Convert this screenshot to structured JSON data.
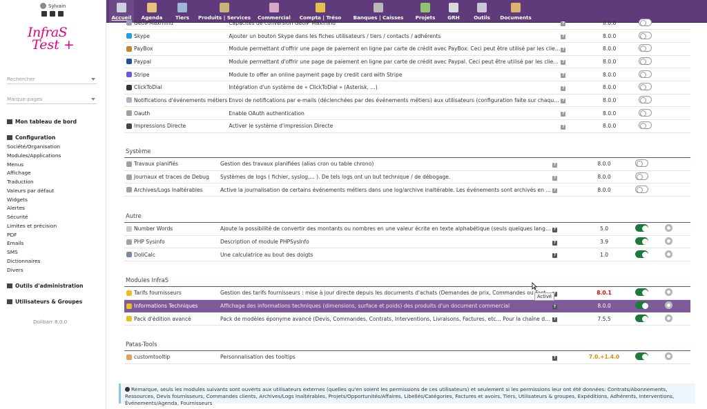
{
  "user": {
    "name": "Sylvain"
  },
  "logo": {
    "line1": "InfraS",
    "line2": "Test +"
  },
  "search": {
    "placeholder": "Rechercher"
  },
  "bookmarks": {
    "placeholder": "Marque-pages"
  },
  "left_menu": {
    "dashboard": "Mon tableau de bord",
    "configuration": "Configuration",
    "config_items": [
      "Société/Organisation",
      "Modules/Applications",
      "Menus",
      "Affichage",
      "Traduction",
      "Valeurs par défaut",
      "Widgets",
      "Alertes",
      "Sécurité",
      "Limites et précision",
      "PDF",
      "Emails",
      "SMS",
      "Dictionnaires",
      "Divers"
    ],
    "admin_tools": "Outils d'administration",
    "users_groups": "Utilisateurs & Groupes",
    "version": "Dolibarr 8.0.0"
  },
  "tabs": [
    {
      "label": "Accueil",
      "color": "#cfcfe0"
    },
    {
      "label": "Agenda",
      "color": "#e7c27a"
    },
    {
      "label": "Tiers",
      "color": "#9db6d8"
    },
    {
      "label": "Produits | Services",
      "color": "#c9b17a"
    },
    {
      "label": "Commercial",
      "color": "#d8a6c8"
    },
    {
      "label": "Compta | Tréso",
      "color": "#e4c04a"
    },
    {
      "label": "Banques | Caisses",
      "color": "#b9b9b9"
    },
    {
      "label": "Projets",
      "color": "#8fc46b"
    },
    {
      "label": "GRH",
      "color": "#d9d9d9"
    },
    {
      "label": "Outils",
      "color": "#c8c8d8"
    },
    {
      "label": "Documents",
      "color": "#d9b56b"
    }
  ],
  "sections": {
    "top": {
      "rows": [
        {
          "name": "GeoIPMaxmind",
          "desc": "Capacités de conversion GeoIP Maxmind",
          "version": "8.0.0",
          "enabled": false,
          "icon": "#9a9ab0"
        },
        {
          "name": "Skype",
          "desc": "Ajouter un bouton Skype dans les fiches utilisateurs / tiers / contacts / adhérents",
          "version": "8.0.0",
          "enabled": false,
          "icon": "#1fa0e0"
        },
        {
          "name": "PayBox",
          "desc": "Module permettant d'offrir une page de paiement en ligne par carte de crédit avec PayBox. Ceci peut être utilisé par les clients pour ...",
          "version": "8.0.0",
          "enabled": false,
          "icon": "#c0862a"
        },
        {
          "name": "Paypal",
          "desc": "Module permettant d'offrir une page de paiement en ligne par carte de crédit avec Paypal. Ceci peut être utilisé par les clients pour f...",
          "version": "8.0.0",
          "enabled": false,
          "icon": "#1d4f9c"
        },
        {
          "name": "Stripe",
          "desc": "Module to offer an online payment page by credit card with Stripe",
          "version": "8.0.0",
          "enabled": false,
          "icon": "#6a5cd8"
        },
        {
          "name": "ClickToDial",
          "desc": "Intégration d'un système de « ClickToDial » (Asterisk, ...)",
          "version": "8.0.0",
          "enabled": false,
          "icon": "#333333"
        },
        {
          "name": "Notifications d'événements métiers",
          "desc": "Envoi de notifications par e-mails (déclenchées par des événements métiers) aux utilisateurs (configuration faite sur chaque fiche u...",
          "version": "8.0.0",
          "enabled": false,
          "icon": "#b0b0c0"
        },
        {
          "name": "Oauth",
          "desc": "Enable OAuth authentication",
          "version": "8.0.0",
          "enabled": false,
          "icon": "#a0a0a0"
        },
        {
          "name": "Impressions Directe",
          "desc": "Activer le système d'impression Directe",
          "version": "8.0.0",
          "enabled": false,
          "icon": "#444444"
        }
      ]
    },
    "systeme": {
      "title": "Système",
      "rows": [
        {
          "name": "Travaux planifiés",
          "desc": "Gestion des travaux planifiées (alias cron ou table chrono)",
          "version": "8.0.0",
          "enabled": false,
          "icon": "#a0a0a0"
        },
        {
          "name": "Journaux et traces de Debug",
          "desc": "Systèmes de logs ( fichier, syslog,... ). De tels logs ont un but technique / de débogage.",
          "version": "8.0.0",
          "enabled": false,
          "icon": "#a0a0a0"
        },
        {
          "name": "Archives/Logs Inaltérables",
          "desc": "Active la journalisation de certains événements métiers dans une log/archive inaltérable. Les événements sont archivés en temps ré...",
          "version": "8.0.0",
          "enabled": false,
          "icon": "#a0a0a0"
        }
      ]
    },
    "autre": {
      "title": "Autre",
      "rows": [
        {
          "name": "Number Words",
          "desc": "Ajoute la possibilité de convertir des montants ou nombres en une valeur écrite en texte alphabétique (seuls quelques languages so...",
          "version": "5.0",
          "enabled": true,
          "icon": "#c8c8c8"
        },
        {
          "name": "PHP Sysinfo",
          "desc": "Description of module PHPSysInfo",
          "version": "3.9",
          "enabled": true,
          "icon": "#a0a0a0"
        },
        {
          "name": "DoliCalc",
          "desc": "Une calculatrice au bout des doigts",
          "version": "1.0",
          "enabled": true,
          "icon": "#7a8aa0"
        }
      ]
    },
    "infras": {
      "title": "Modules InfraS",
      "rows": [
        {
          "name": "Tarifs fournisseurs",
          "desc": "Gestion des tarifs fournisseurs : mise à jour directe depuis les documents d'achats (Demandes de prix, Commandes ou Factures)",
          "version": "8.0.1",
          "enabled": true,
          "icon": "#e8c020",
          "vclass": "ver-red"
        },
        {
          "name": "Informations Techniques",
          "desc": "Affichage des informations techniques (dimensions, surface et poids) des produits d'un document commercial",
          "version": "8.0.0",
          "enabled": true,
          "icon": "#e8c020",
          "vclass": "",
          "highlight": true
        },
        {
          "name": "Pack d'édition avancé",
          "desc": "Pack de modèles éponyme avancé (Devis, Commandes, Contrats, Interventions, Livraisons, Factures, etc... Pour la chaîne des ventes ...",
          "version": "7.5.5",
          "enabled": true,
          "icon": "#e8c020",
          "vclass": ""
        }
      ]
    },
    "patas": {
      "title": "Patas-Tools",
      "rows": [
        {
          "name": "customtooltip",
          "desc": "Personnalisation des tooltips",
          "version": "7.0.+1.4.0",
          "enabled": true,
          "icon": "#e0a060",
          "vclass": "ver-orange"
        }
      ]
    }
  },
  "tooltip": "Activé",
  "note": "Remarque, seuls les modules suivants sont ouverts aux utilisateurs externes (quelles qu'en soient les permissions de ces utilisateurs) et seulement si les permissions leur ont été données: Contrats/Abonnements, Ressources, Devis fournisseurs, Commandes clients, Archives/Logs Inaltérables, Projets/Opportunités/Affaires, Libellés/Catégories, Factures et avoirs, Tiers, Utilisateurs & groupes, Expéditions, Adhérents, Interventions, Événements/Agenda, Fournisseurs"
}
